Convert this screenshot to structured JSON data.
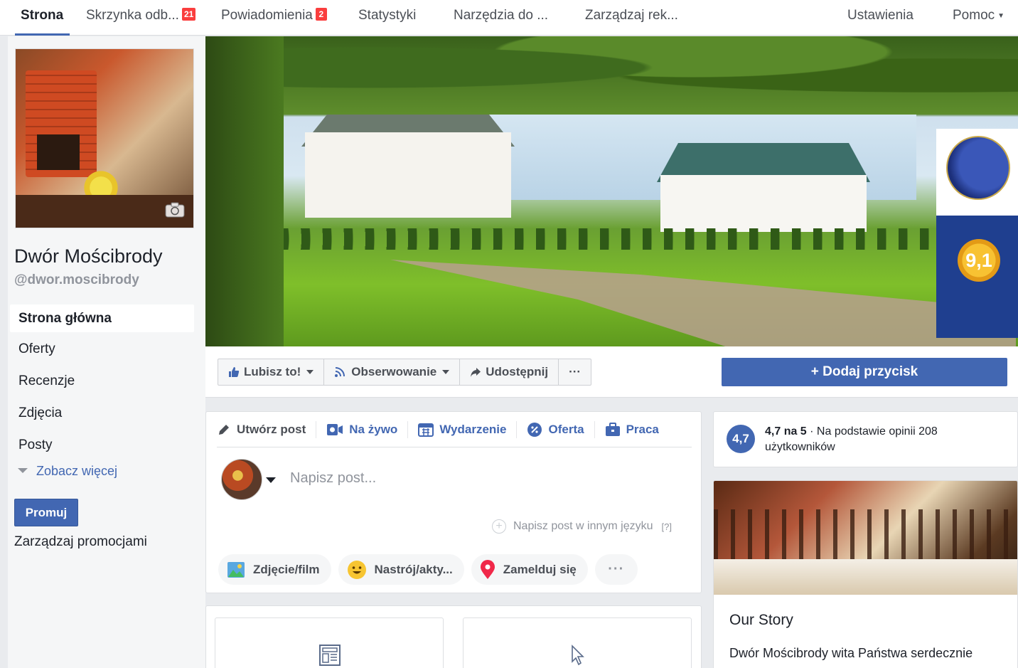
{
  "tabs": [
    {
      "label": "Strona",
      "active": true
    },
    {
      "label": "Skrzynka odb...",
      "badge": "21"
    },
    {
      "label": "Powiadomienia",
      "badge": "2"
    },
    {
      "label": "Statystyki"
    },
    {
      "label": "Narzędzia do ..."
    },
    {
      "label": "Zarządzaj rek..."
    },
    {
      "label": "Ustawienia"
    },
    {
      "label": "Pomoc"
    }
  ],
  "page": {
    "name": "Dwór Mościbrody",
    "handle": "@dwor.moscibrody"
  },
  "nav": [
    "Strona główna",
    "Oferty",
    "Recenzje",
    "Zdjęcia",
    "Posty"
  ],
  "see_more": "Zobacz więcej",
  "promote": {
    "button": "Promuj",
    "manage": "Zarządzaj promocjami"
  },
  "cover": {
    "award_score": "9,1"
  },
  "actions": {
    "like": "Lubisz to!",
    "follow": "Obserwowanie",
    "share": "Udostępnij",
    "more": "···",
    "add_button": "+ Dodaj przycisk"
  },
  "composer": {
    "tabs": [
      "Utwórz post",
      "Na żywo",
      "Wydarzenie",
      "Oferta",
      "Praca"
    ],
    "placeholder": "Napisz post...",
    "other_language": "Napisz post w innym języku",
    "help": "[?]",
    "pills": [
      "Zdjęcie/film",
      "Nastrój/akty...",
      "Zamelduj się"
    ],
    "more": "···"
  },
  "rating": {
    "score": "4,7",
    "bold": "4,7 na 5",
    "text": " · Na podstawie opinii 208 użytkowników"
  },
  "story": {
    "title": "Our Story",
    "text": "Dwór Mościbrody wita Państwa serdecznie"
  },
  "colors": {
    "brand": "#4267b2",
    "badge": "#fa3e3e"
  }
}
